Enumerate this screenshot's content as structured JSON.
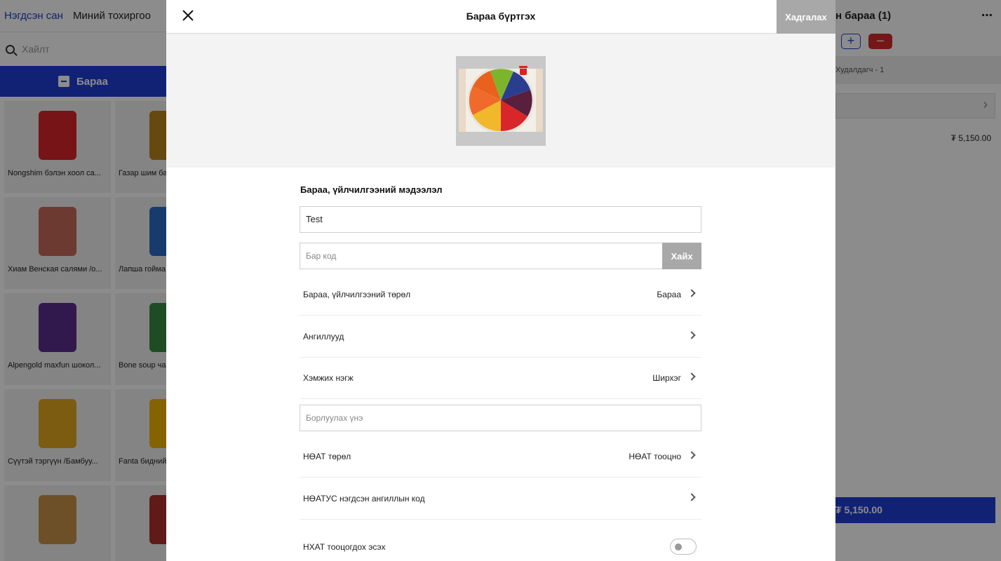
{
  "background": {
    "tabs": [
      "Нэгдсэн сан",
      "Миний тохиргоо"
    ],
    "search_placeholder": "Хайлт",
    "category_label": "Бараа",
    "products": [
      {
        "name": "Nongshim бэлэн хоол са...",
        "color": "#d8262a"
      },
      {
        "name": "Газар шим ба...",
        "color": "#b8861b"
      },
      {
        "name": "Хиам Венская салями /о...",
        "color": "#c76a5a"
      },
      {
        "name": "Лапша гойма...",
        "color": "#2c6cc8"
      },
      {
        "name": "Alpengold maxfun шокол...",
        "color": "#5a2f8c"
      },
      {
        "name": "Bone soup ча...",
        "color": "#3a8a44"
      },
      {
        "name": "Сүүтэй тэргүүн /Бамбуу...",
        "color": "#e0a820"
      },
      {
        "name": "Fanta бидний...",
        "color": "#f2b400"
      },
      {
        "name": "",
        "color": "#c9924a"
      },
      {
        "name": "",
        "color": "#b0302a"
      }
    ],
    "cart_title": "н бараа (1)",
    "more_icon": "⋯",
    "plus_label": "+",
    "minus_label": "–",
    "seller_label": "Худалдагч - 1",
    "line_price": "₮ 5,150.00",
    "pay_label": "₮ 5,150.00"
  },
  "modal": {
    "title": "Бараа бүртгэх",
    "save_label": "Хадгалах",
    "section_title": "Бараа, үйлчилгээний мэдээлэл",
    "name_value": "Test",
    "barcode_placeholder": "Бар код",
    "search_label": "Хайх",
    "rows": [
      {
        "label": "Бараа, үйлчилгээний төрөл",
        "value": "Бараа"
      },
      {
        "label": "Ангиллууд",
        "value": ""
      },
      {
        "label": "Хэмжих нэгж",
        "value": "Ширхэг"
      }
    ],
    "price_placeholder": "Борлуулах үнэ",
    "rows2": [
      {
        "label": "НӨАТ төрөл",
        "value": "НӨАТ тооцно"
      },
      {
        "label": "НӨАТУС нэгдсэн ангиллын код",
        "value": ""
      }
    ],
    "toggle_label": "НХАТ тооцогдох эсэх",
    "toggle_on": false
  }
}
